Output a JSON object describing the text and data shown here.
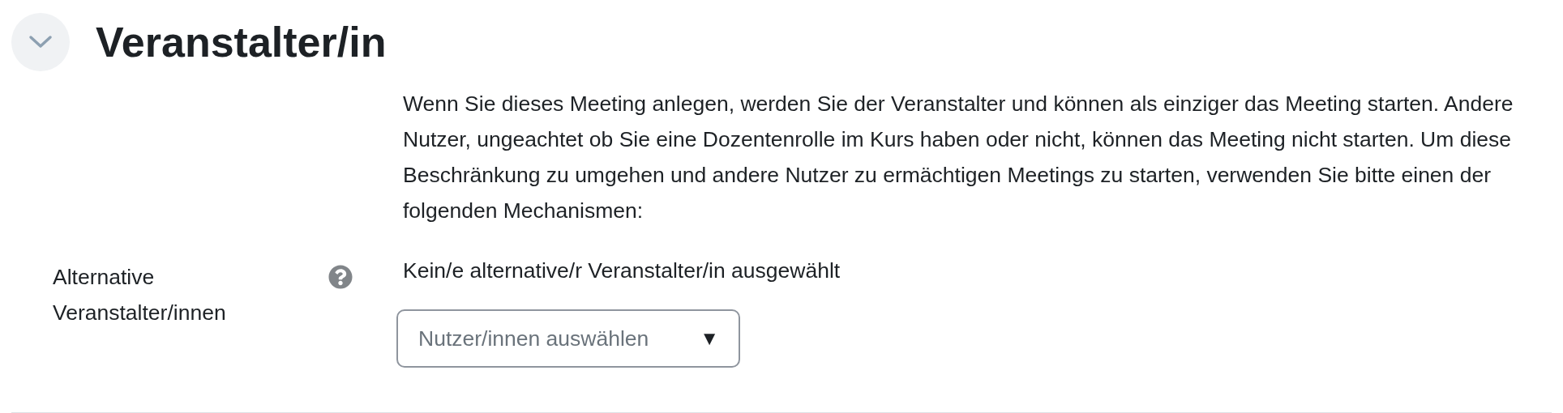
{
  "section": {
    "title": "Veranstalter/in",
    "expanded": true
  },
  "description": "Wenn Sie dieses Meeting anlegen, werden Sie der Veranstalter und können als einziger das Meeting starten. Andere Nutzer, ungeachtet ob Sie eine Dozentenrolle im Kurs haben oder nicht, können das Meeting nicht starten. Um diese Beschränkung zu umgehen und andere Nutzer zu ermächtigen Meetings zu starten, verwenden Sie bitte einen der folgenden Mechanismen:",
  "field": {
    "label": "Alternative Veranstalter/innen",
    "selection": "Kein/e alternative/r Veranstalter/in ausgewählt",
    "select": {
      "placeholder": "Nutzer/innen auswählen",
      "caret": "▼"
    }
  }
}
